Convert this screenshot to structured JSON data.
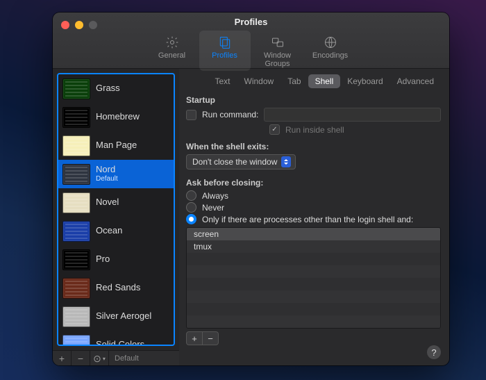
{
  "window": {
    "title": "Profiles"
  },
  "toolbar": {
    "items": [
      {
        "label": "General",
        "active": false
      },
      {
        "label": "Profiles",
        "active": true
      },
      {
        "label": "Window Groups",
        "active": false
      },
      {
        "label": "Encodings",
        "active": false
      }
    ]
  },
  "sidebar": {
    "profiles": [
      {
        "name": "Grass",
        "swatch": "#0a3f0a",
        "selected": false
      },
      {
        "name": "Homebrew",
        "swatch": "#000000",
        "selected": false
      },
      {
        "name": "Man Page",
        "swatch": "#f6efb9",
        "selected": false
      },
      {
        "name": "Nord",
        "sub": "Default",
        "swatch": "#2e3440",
        "selected": true
      },
      {
        "name": "Novel",
        "swatch": "#e6dec1",
        "selected": false
      },
      {
        "name": "Ocean",
        "swatch": "#1a3ea8",
        "selected": false
      },
      {
        "name": "Pro",
        "swatch": "#000000",
        "selected": false
      },
      {
        "name": "Red Sands",
        "swatch": "#6a2a1a",
        "selected": false
      },
      {
        "name": "Silver Aerogel",
        "swatch": "#b8b8b8",
        "selected": false
      },
      {
        "name": "Solid Colors",
        "swatch": "#7aa6ff",
        "selected": false
      }
    ],
    "footer": {
      "add": "+",
      "remove": "−",
      "menu": "⊙",
      "default_label": "Default"
    }
  },
  "tabs": [
    {
      "label": "Text",
      "selected": false
    },
    {
      "label": "Window",
      "selected": false
    },
    {
      "label": "Tab",
      "selected": false
    },
    {
      "label": "Shell",
      "selected": true
    },
    {
      "label": "Keyboard",
      "selected": false
    },
    {
      "label": "Advanced",
      "selected": false
    }
  ],
  "shell": {
    "startup_heading": "Startup",
    "run_command_label": "Run command:",
    "run_command_checked": false,
    "run_inside_shell_label": "Run inside shell",
    "run_inside_shell_checked": true,
    "exit_heading": "When the shell exits:",
    "exit_action": "Don't close the window",
    "ask_heading": "Ask before closing:",
    "ask_options": [
      {
        "label": "Always",
        "selected": false
      },
      {
        "label": "Never",
        "selected": false
      },
      {
        "label": "Only if there are processes other than the login shell and:",
        "selected": true
      }
    ],
    "processes": [
      "screen",
      "tmux"
    ],
    "proc_add": "+",
    "proc_remove": "−",
    "help": "?"
  }
}
